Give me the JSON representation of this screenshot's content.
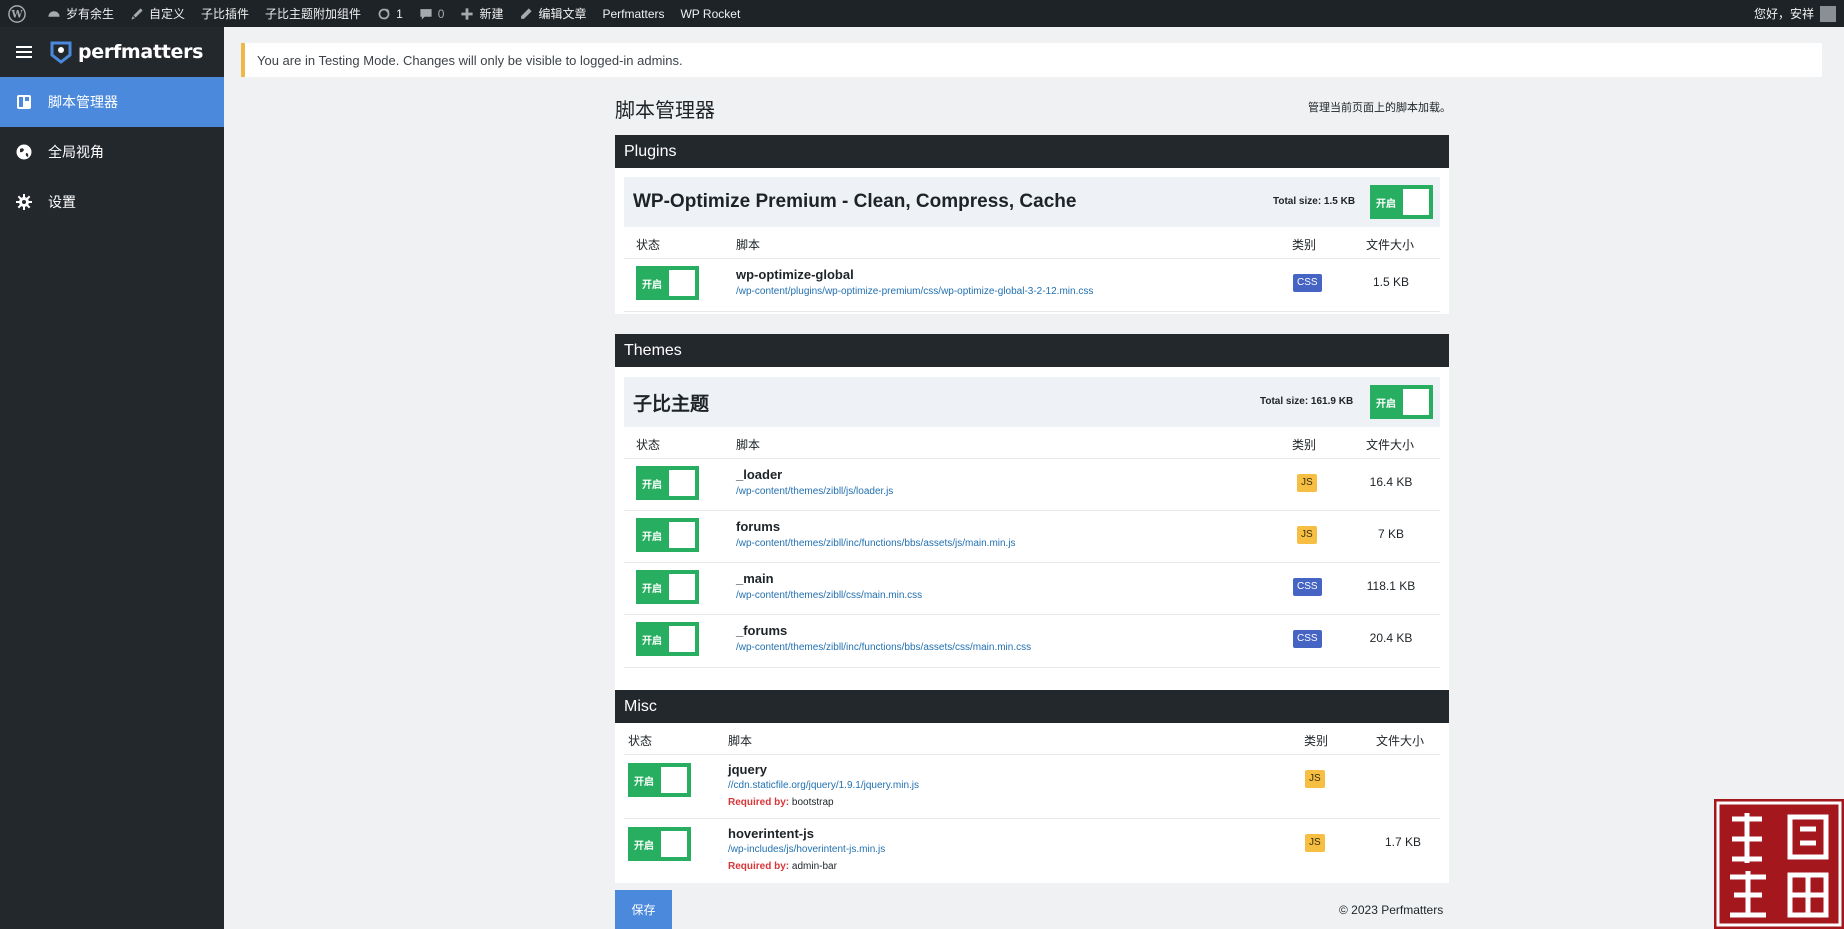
{
  "admin_bar": {
    "items": [
      "岁有余生",
      "自定义",
      "子比插件",
      "子比主题附加组件",
      "1",
      "0",
      "新建",
      "编辑文章",
      "Perfmatters",
      "WP Rocket"
    ],
    "greeting": "您好，安祥"
  },
  "sidebar": {
    "brand": "perfmatters",
    "items": [
      {
        "label": "脚本管理器",
        "icon": "dashboard-icon",
        "active": true
      },
      {
        "label": "全局视角",
        "icon": "globe-icon",
        "active": false
      },
      {
        "label": "设置",
        "icon": "gear-icon",
        "active": false
      }
    ]
  },
  "notice": "You are in Testing Mode. Changes will only be visible to logged-in admins.",
  "page": {
    "title": "脚本管理器",
    "description": "管理当前页面上的脚本加载。"
  },
  "columns": {
    "status": "状态",
    "script": "脚本",
    "type": "类别",
    "size": "文件大小"
  },
  "toggle_label": "开启",
  "sections": {
    "plugins": {
      "title": "Plugins",
      "group": {
        "name": "WP-Optimize Premium - Clean, Compress, Cache",
        "total": "Total size: 1.5 KB",
        "rows": [
          {
            "name": "wp-optimize-global",
            "path": "/wp-content/plugins/wp-optimize-premium/css/wp-optimize-global-3-2-12.min.css",
            "type": "CSS",
            "size": "1.5 KB"
          }
        ]
      }
    },
    "themes": {
      "title": "Themes",
      "group": {
        "name": "子比主题",
        "total": "Total size: 161.9 KB",
        "rows": [
          {
            "name": "_loader",
            "path": "/wp-content/themes/zibll/js/loader.js",
            "type": "JS",
            "size": "16.4 KB"
          },
          {
            "name": "forums",
            "path": "/wp-content/themes/zibll/inc/functions/bbs/assets/js/main.min.js",
            "type": "JS",
            "size": "7 KB"
          },
          {
            "name": "_main",
            "path": "/wp-content/themes/zibll/css/main.min.css",
            "type": "CSS",
            "size": "118.1 KB"
          },
          {
            "name": "_forums",
            "path": "/wp-content/themes/zibll/inc/functions/bbs/assets/css/main.min.css",
            "type": "CSS",
            "size": "20.4 KB"
          }
        ]
      }
    },
    "misc": {
      "title": "Misc",
      "rows": [
        {
          "name": "jquery",
          "path": "//cdn.staticfile.org/jquery/1.9.1/jquery.min.js",
          "required_label": "Required by:",
          "required": "bootstrap",
          "type": "JS",
          "size": ""
        },
        {
          "name": "hoverintent-js",
          "path": "/wp-includes/js/hoverintent-js.min.js",
          "required_label": "Required by:",
          "required": "admin-bar",
          "type": "JS",
          "size": "1.7 KB"
        }
      ]
    }
  },
  "save_label": "保存",
  "footer": "© 2023 Perfmatters",
  "colors": {
    "accent": "#4a89dc",
    "toggle_on": "#27ae60",
    "css_badge": "#4564c4",
    "js_badge": "#f6bf44",
    "dark": "#23282d"
  }
}
